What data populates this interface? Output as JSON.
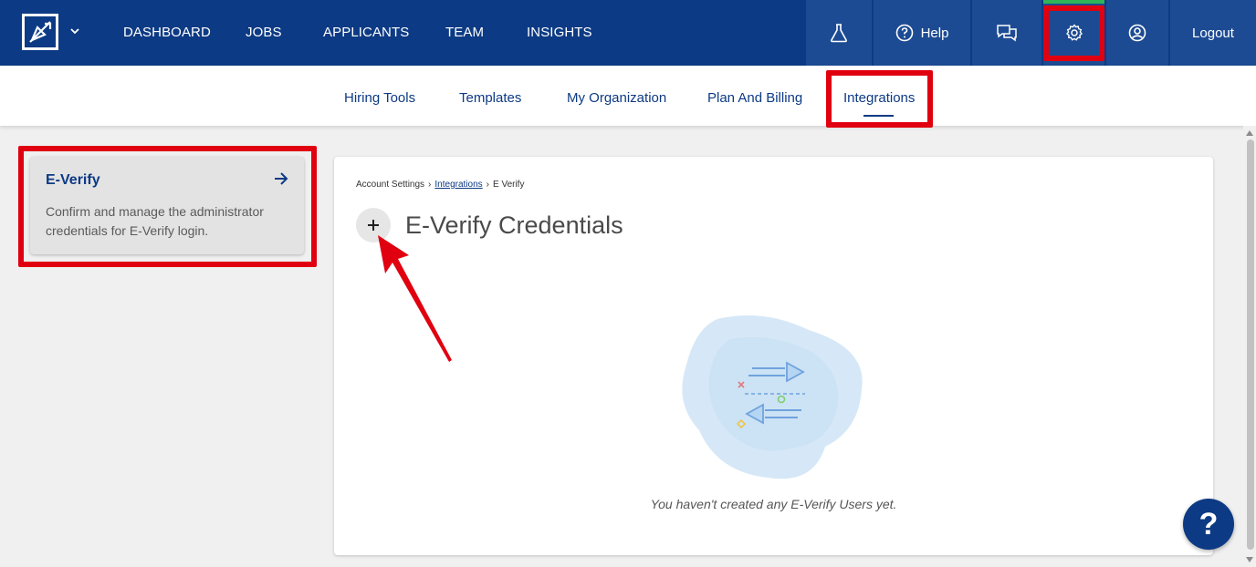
{
  "nav": {
    "links": [
      "DASHBOARD",
      "JOBS",
      "APPLICANTS",
      "TEAM",
      "INSIGHTS"
    ],
    "help_label": "Help",
    "logout_label": "Logout"
  },
  "subnav": {
    "tabs": [
      "Hiring Tools",
      "Templates",
      "My Organization",
      "Plan And Billing",
      "Integrations"
    ],
    "active": "Integrations"
  },
  "sidebar": {
    "card_title": "E-Verify",
    "card_description": "Confirm and manage the administrator credentials for E-Verify login."
  },
  "breadcrumb": {
    "items": [
      "Account Settings",
      "Integrations",
      "E Verify"
    ],
    "separator": "›"
  },
  "main": {
    "title": "E-Verify Credentials",
    "empty_message": "You haven't created any E-Verify Users yet."
  },
  "help_fab": "?",
  "colors": {
    "navy": "#0d3a84",
    "nav_block": "#1d4b93",
    "highlight": "#e00010",
    "active_indicator": "#2fb457"
  },
  "icons": [
    "logo-icon",
    "chevron-down-icon",
    "flask-icon",
    "help-circle-icon",
    "chat-icon",
    "gear-icon",
    "user-circle-icon",
    "arrow-right-icon",
    "plus-icon"
  ]
}
